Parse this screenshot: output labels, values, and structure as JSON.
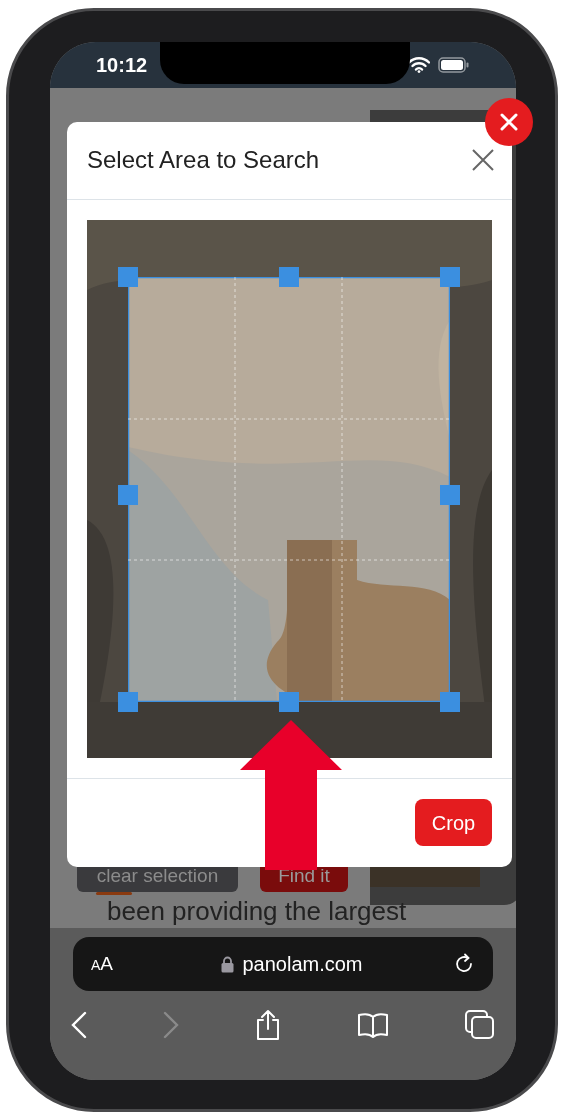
{
  "status_bar": {
    "time": "10:12"
  },
  "background_page": {
    "buttons": [
      {
        "label": "clear selection",
        "kind": "secondary"
      },
      {
        "label": "Find it",
        "kind": "primary"
      }
    ],
    "text": "been providing the largest"
  },
  "modal": {
    "title": "Select Area to Search",
    "crop_button": "Crop"
  },
  "browser": {
    "text_size_button": "AA",
    "url": "panolam.com"
  }
}
